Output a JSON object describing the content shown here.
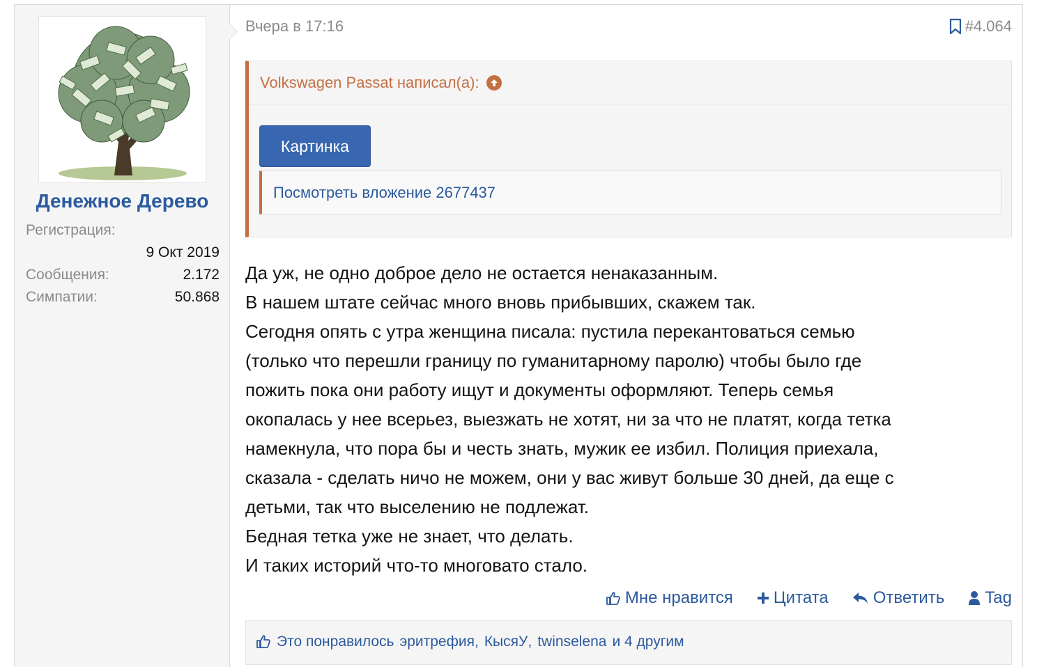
{
  "user": {
    "name": "Денежное Дерево",
    "stats": [
      {
        "label": "Регистрация:",
        "value": ""
      },
      {
        "label": "",
        "value": "9 Окт 2019"
      },
      {
        "label": "Сообщения:",
        "value": "2.172"
      },
      {
        "label": "Симпатии:",
        "value": "50.868"
      }
    ]
  },
  "post": {
    "date": "Вчера в 17:16",
    "number": "#4.064",
    "quote": {
      "author_line": "Volkswagen Passat написал(а):",
      "spoiler_label": "Картинка",
      "attachment_text": "Посмотреть вложение 2677437"
    },
    "lines": [
      "Да уж, не одно доброе дело не остается ненаказанным.",
      "В нашем штате сейчас много вновь прибывших, скажем так.",
      "Сегодня опять с утра женщина писала: пустила перекантоваться семью",
      "(только что перешли границу по гуманитарному паролю) чтобы было где",
      "пожить пока они работу ищут и документы оформляют. Теперь семья",
      "окопалась у нее всерьез, выезжать не хотят, ни за что не платят, когда тетка",
      "намекнула, что пора бы и честь знать, мужик ее избил. Полиция приехала,",
      "сказала - сделать ничо не можем, они у вас живут больше 30 дней, да еще с",
      "детьми, так что выселению не подлежат.",
      "Бедная тетка уже не знает, что делать.",
      "И таких историй что-то многовато стало."
    ],
    "actions": {
      "like": "Мне нравится",
      "quote": "Цитата",
      "reply": "Ответить",
      "tag": "Tag"
    },
    "likes": {
      "prefix": "Это понравилось",
      "user1": "эритрефия",
      "sep1": ",",
      "user2": "КысяУ",
      "sep2": ",",
      "user3": "twinselena",
      "suffix": "и 4 другим"
    }
  },
  "colors": {
    "link": "#2c5a9e",
    "quote_accent": "#c46f42",
    "button": "#3866b0",
    "muted": "#8a8a8a"
  }
}
